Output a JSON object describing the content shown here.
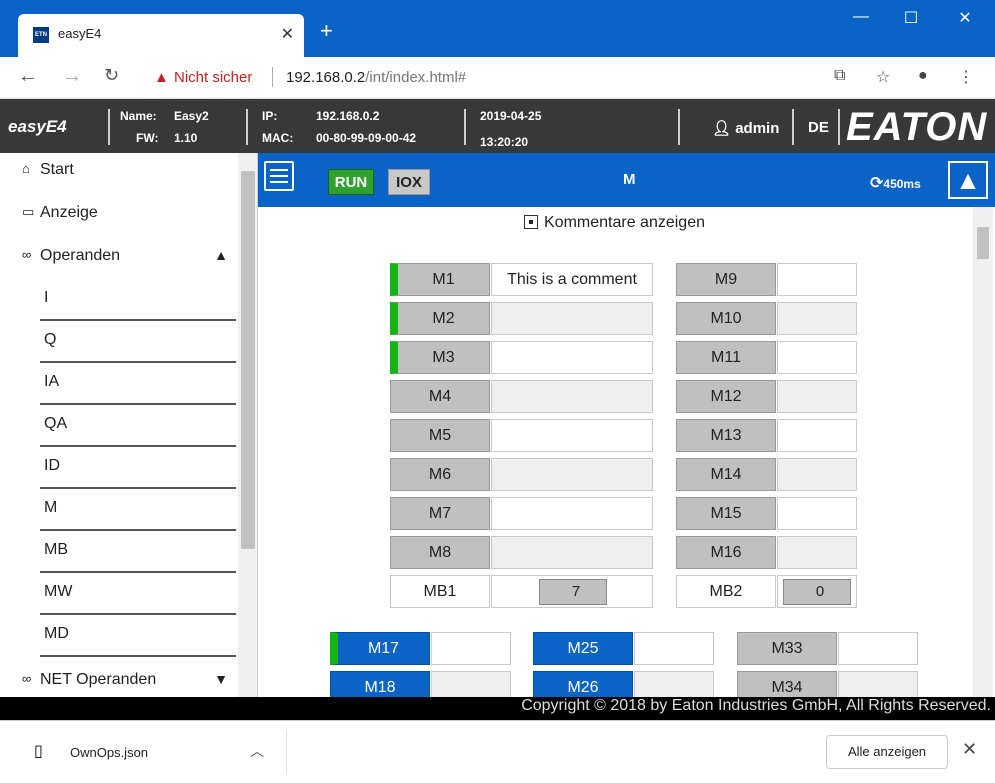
{
  "browser": {
    "tab_title": "easyE4",
    "favicon_text": "ETN",
    "insecure_label": "Nicht sicher",
    "url_host": "192.168.0.2",
    "url_path": "/int/index.html#"
  },
  "header": {
    "brand": "easyE4",
    "name_label": "Name:",
    "name_value": "Easy2",
    "fw_label": "FW:",
    "fw_value": "1.10",
    "ip_label": "IP:",
    "ip_value": "192.168.0.2",
    "mac_label": "MAC:",
    "mac_value": "00-80-99-09-00-42",
    "date": "2019-04-25",
    "time": "13:20:20",
    "user": "admin",
    "language": "DE",
    "logo_text": "EATON"
  },
  "sidebar": {
    "start": "Start",
    "anzeige": "Anzeige",
    "operanden": "Operanden",
    "sub_items": [
      "I",
      "Q",
      "IA",
      "QA",
      "ID",
      "M",
      "MB",
      "MW",
      "MD"
    ],
    "net_operanden": "NET Operanden"
  },
  "toolbar": {
    "run_label": "RUN",
    "iox_label": "IOX",
    "title": "M",
    "refresh_interval": "450ms"
  },
  "comments_toggle": "Kommentare anzeigen",
  "markers_left": [
    {
      "name": "M1",
      "comment": "This is a comment",
      "active": true,
      "readonly": false
    },
    {
      "name": "M2",
      "comment": "",
      "active": true,
      "readonly": true
    },
    {
      "name": "M3",
      "comment": "",
      "active": true,
      "readonly": false
    },
    {
      "name": "M4",
      "comment": "",
      "active": false,
      "readonly": true
    },
    {
      "name": "M5",
      "comment": "",
      "active": false,
      "readonly": false
    },
    {
      "name": "M6",
      "comment": "",
      "active": false,
      "readonly": true
    },
    {
      "name": "M7",
      "comment": "",
      "active": false,
      "readonly": false
    },
    {
      "name": "M8",
      "comment": "",
      "active": false,
      "readonly": true
    }
  ],
  "markers_right": [
    {
      "name": "M9",
      "readonly": false
    },
    {
      "name": "M10",
      "readonly": true
    },
    {
      "name": "M11",
      "readonly": false
    },
    {
      "name": "M12",
      "readonly": true
    },
    {
      "name": "M13",
      "readonly": false
    },
    {
      "name": "M14",
      "readonly": true
    },
    {
      "name": "M15",
      "readonly": false
    },
    {
      "name": "M16",
      "readonly": true
    }
  ],
  "mb": [
    {
      "name": "MB1",
      "value": "7"
    },
    {
      "name": "MB2",
      "value": "0"
    }
  ],
  "lower_markers": {
    "row1": [
      {
        "name": "M17",
        "style": "blue",
        "active": true
      },
      {
        "name": "M25",
        "style": "blue",
        "active": false
      },
      {
        "name": "M33",
        "style": "grey",
        "active": false
      }
    ],
    "row2": [
      {
        "name": "M18",
        "style": "blue",
        "active": false
      },
      {
        "name": "M26",
        "style": "blue",
        "active": false
      },
      {
        "name": "M34",
        "style": "grey",
        "active": false
      }
    ]
  },
  "footer": "Copyright © 2018 by Eaton Industries GmbH, All Rights Reserved.",
  "downloads": {
    "file": "OwnOps.json",
    "show_all": "Alle anzeigen"
  }
}
